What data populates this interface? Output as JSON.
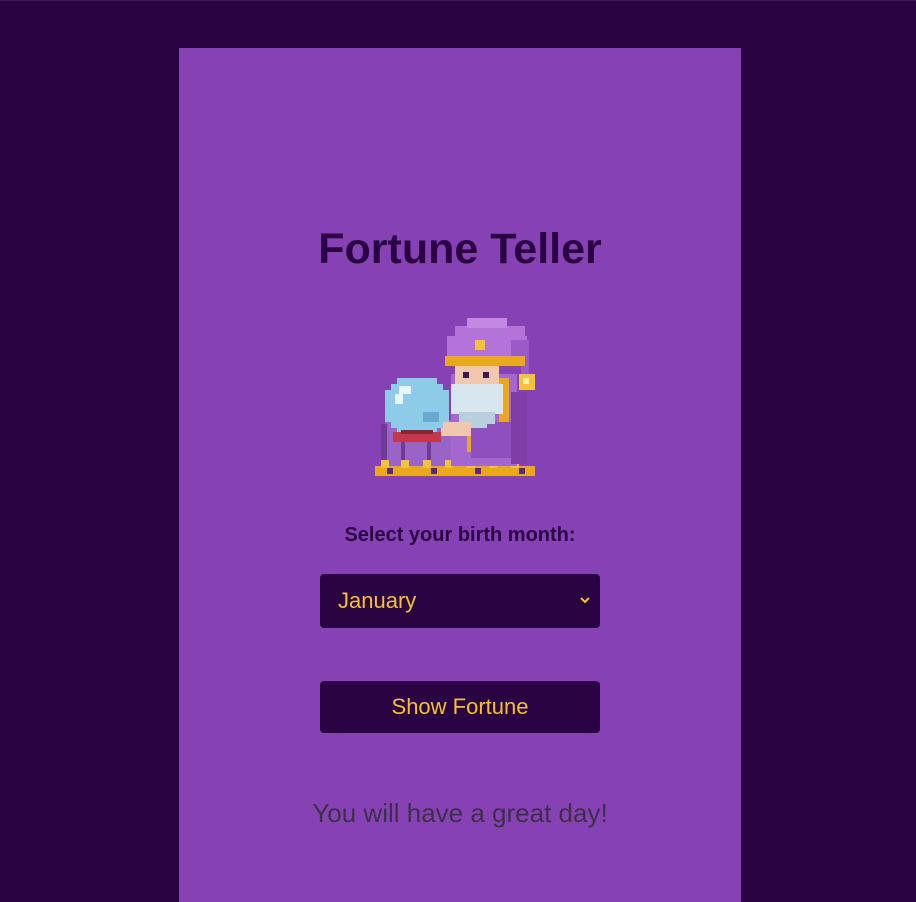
{
  "app": {
    "title": "Fortune Teller"
  },
  "illustration": {
    "icon": "wizard-crystal-ball-icon"
  },
  "form": {
    "month_label": "Select your birth month:",
    "month_selected": "January",
    "submit_label": "Show Fortune"
  },
  "result": {
    "fortune_text": "You will have a great day!"
  },
  "colors": {
    "page_background": "#2a0342",
    "panel_background": "#8642b4",
    "control_background": "#2a0342",
    "accent_text": "#f5c133",
    "title_text": "#2a0342",
    "fortune_text": "#3d2f4a"
  }
}
